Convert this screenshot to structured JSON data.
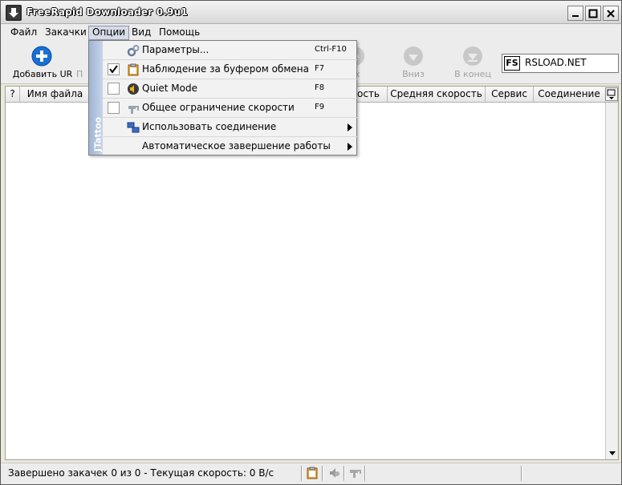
{
  "window": {
    "title": "FreeRapid Downloader 0.9u1"
  },
  "menubar": {
    "items": [
      "Файл",
      "Закачки",
      "Опции",
      "Вид",
      "Помощь"
    ],
    "active_index": 2
  },
  "toolbar": {
    "add_url_label": "Добавить UR",
    "partial_label": "П",
    "up_label": "рх",
    "down_label": "Вниз",
    "to_end_label": "В конец",
    "service_logo": "FS",
    "service_name": "RSLOAD.NET"
  },
  "table": {
    "columns": [
      "?",
      "Имя файла",
      "ость",
      "Средняя скорость",
      "Сервис",
      "Соединение"
    ]
  },
  "options_menu": {
    "strip_label": "JTattoo",
    "items": [
      {
        "label": "Параметры...",
        "accelerator": "Ctrl-F10",
        "icon": "gear-icon",
        "checkbox": false,
        "checked": false,
        "submenu": false
      },
      {
        "label": "Наблюдение за буфером обмена",
        "accelerator": "F7",
        "icon": "clipboard-icon",
        "checkbox": true,
        "checked": true,
        "submenu": false
      },
      {
        "label": "Quiet Mode",
        "accelerator": "F8",
        "icon": "speaker-icon",
        "checkbox": true,
        "checked": false,
        "submenu": false
      },
      {
        "label": "Общее ограничение скорости",
        "accelerator": "F9",
        "icon": "speed-limit-icon",
        "checkbox": true,
        "checked": false,
        "submenu": false
      },
      {
        "label": "Использовать соединение",
        "accelerator": "",
        "icon": "connection-icon",
        "checkbox": false,
        "checked": false,
        "submenu": true
      },
      {
        "label": "Автоматическое завершение работы",
        "accelerator": "",
        "icon": "",
        "checkbox": false,
        "checked": false,
        "submenu": true
      }
    ]
  },
  "statusbar": {
    "text": "Завершено закачек 0 из 0 - Текущая скорость: 0 В/с"
  },
  "colors": {
    "menu_active": "#d6dbe6",
    "menu_strip": "#9fb4d3",
    "add_button": "#1a6fd6"
  }
}
